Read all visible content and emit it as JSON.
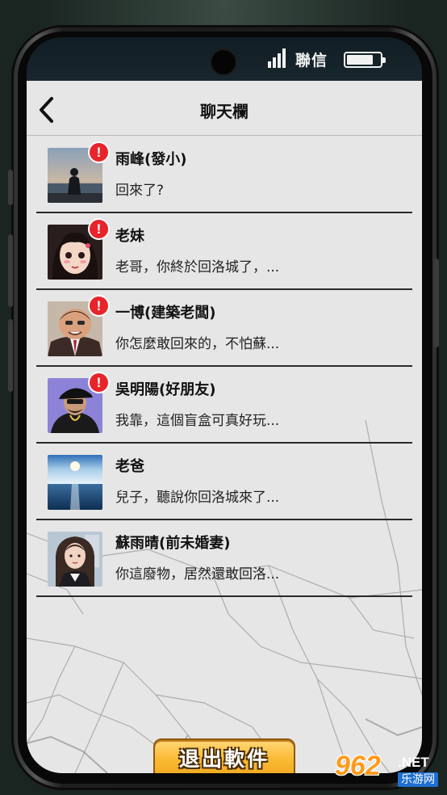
{
  "status_bar": {
    "carrier": "聯信",
    "battery_level": 0.8,
    "signal_bars": 4
  },
  "header": {
    "title": "聊天欄",
    "back_icon": "chevron-left-icon"
  },
  "chats": [
    {
      "name": "雨峰(發小)",
      "preview": "回來了?",
      "unread": true,
      "badge": "!"
    },
    {
      "name": "老妹",
      "preview": "老哥，你終於回洛城了，...",
      "unread": true,
      "badge": "!"
    },
    {
      "name": "一博(建築老闆)",
      "preview": "你怎麼敢回來的，不怕蘇...",
      "unread": true,
      "badge": "!"
    },
    {
      "name": "吳明陽(好朋友)",
      "preview": "我靠，這個盲盒可真好玩...",
      "unread": true,
      "badge": "!"
    },
    {
      "name": "老爸",
      "preview": "兒子，聽說你回洛城來了...",
      "unread": false,
      "badge": ""
    },
    {
      "name": "蘇雨晴(前未婚妻)",
      "preview": "你這廢物，居然還敢回洛...",
      "unread": false,
      "badge": ""
    }
  ],
  "exit_button": {
    "label": "退出軟件"
  },
  "watermark": {
    "logo": "962",
    "suffix": ".NET",
    "sub": "乐游网"
  },
  "colors": {
    "badge": "#e8242a",
    "button": "#fbbb36",
    "screen_bg": "#e6e6e6"
  }
}
